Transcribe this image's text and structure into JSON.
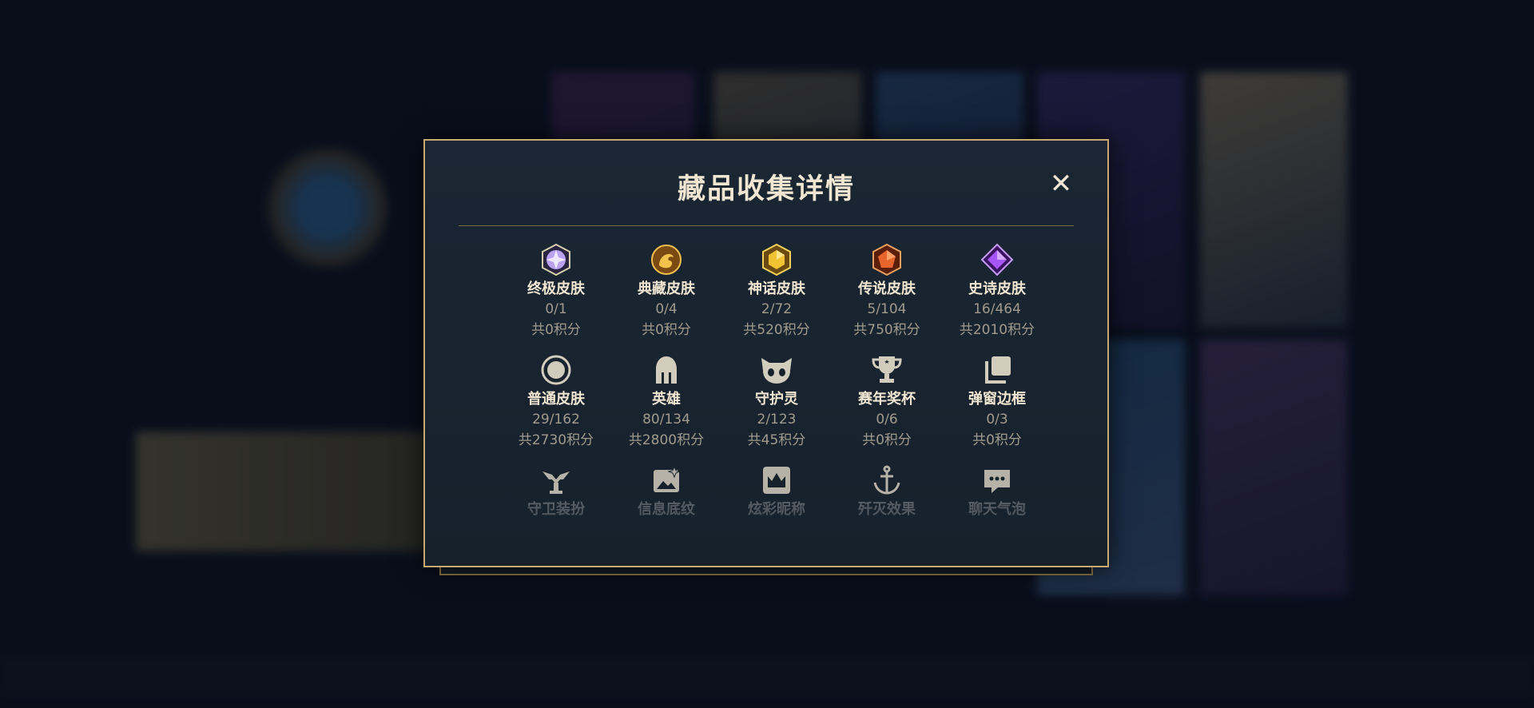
{
  "modal": {
    "title": "藏品收集详情",
    "close_symbol": "✕"
  },
  "items": [
    {
      "name": "终极皮肤",
      "count": "0/1",
      "points": "共0积分",
      "icon": "ultimate-gem-icon",
      "color": "#b9a3f0"
    },
    {
      "name": "典藏皮肤",
      "count": "0/4",
      "points": "共0积分",
      "icon": "prestige-dragon-icon",
      "color": "#e0a83a"
    },
    {
      "name": "神话皮肤",
      "count": "2/72",
      "points": "共520积分",
      "icon": "mythic-gem-icon",
      "color": "#f1c232"
    },
    {
      "name": "传说皮肤",
      "count": "5/104",
      "points": "共750积分",
      "icon": "legendary-gem-icon",
      "color": "#e8662e"
    },
    {
      "name": "史诗皮肤",
      "count": "16/464",
      "points": "共2010积分",
      "icon": "epic-gem-icon",
      "color": "#a855f7"
    },
    {
      "name": "普通皮肤",
      "count": "29/162",
      "points": "共2730积分",
      "icon": "standard-circle-icon",
      "color": "#c9c4b8"
    },
    {
      "name": "英雄",
      "count": "80/134",
      "points": "共2800积分",
      "icon": "helmet-icon",
      "color": "#c9c4b8"
    },
    {
      "name": "守护灵",
      "count": "2/123",
      "points": "共45积分",
      "icon": "little-legend-icon",
      "color": "#c9c4b8"
    },
    {
      "name": "赛年奖杯",
      "count": "0/6",
      "points": "共0积分",
      "icon": "trophy-icon",
      "color": "#c9c4b8"
    },
    {
      "name": "弹窗边框",
      "count": "0/3",
      "points": "共0积分",
      "icon": "frame-icon",
      "color": "#c9c4b8"
    },
    {
      "name": "守卫装扮",
      "icon": "ward-icon",
      "color": "#c9c4b8"
    },
    {
      "name": "信息底纹",
      "icon": "banner-icon",
      "color": "#c9c4b8"
    },
    {
      "name": "炫彩昵称",
      "icon": "crown-icon",
      "color": "#c9c4b8"
    },
    {
      "name": "歼灭效果",
      "icon": "anchor-icon",
      "color": "#c9c4b8"
    },
    {
      "name": "聊天气泡",
      "icon": "chat-bubble-icon",
      "color": "#c9c4b8"
    }
  ],
  "colors": {
    "gold_border": "#c8aa6e",
    "modal_bg": "#1a2633",
    "title_text": "#f0e6d2",
    "muted_text": "#a09b8c"
  }
}
